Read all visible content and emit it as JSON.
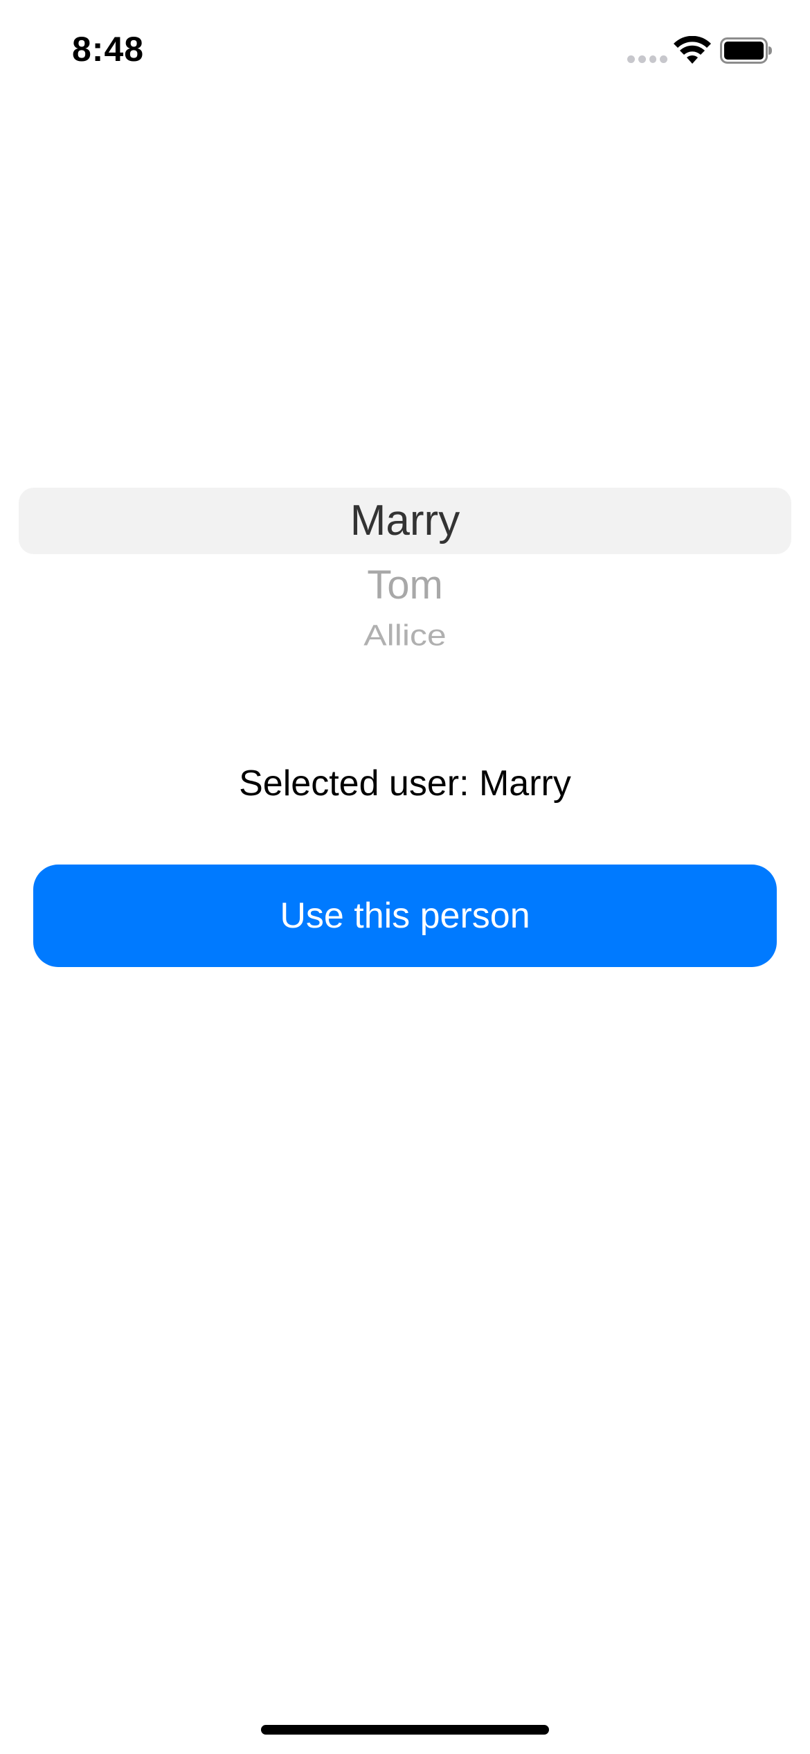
{
  "status_bar": {
    "time": "8:48",
    "icons": [
      "cellular-signal-icon",
      "wifi-icon",
      "battery-icon"
    ]
  },
  "picker": {
    "options": [
      "Marry",
      "Tom",
      "Allice"
    ],
    "selected": "Marry"
  },
  "selected_label": "Selected user: Marry",
  "button": {
    "label": "Use this person",
    "color": "#007aff"
  },
  "colors": {
    "accent": "#007aff",
    "picker_highlight": "#f2f2f2"
  }
}
